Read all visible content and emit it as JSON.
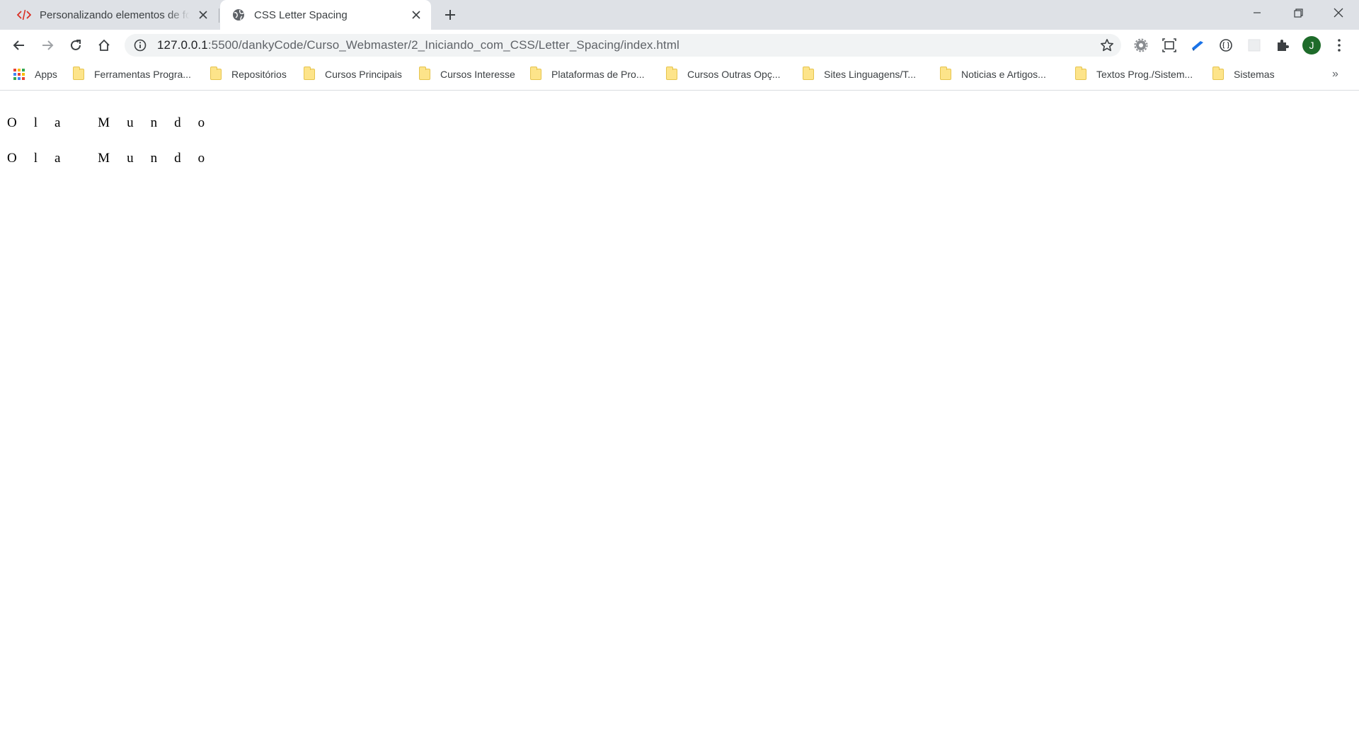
{
  "tabs": [
    {
      "title": "Personalizando elementos de formulário",
      "favicon": "code-icon",
      "active": false
    },
    {
      "title": "CSS Letter Spacing",
      "favicon": "globe-icon",
      "active": true
    }
  ],
  "window_controls": [
    "minimize",
    "restore",
    "close"
  ],
  "toolbar": {
    "url_host": "127.0.0.1",
    "url_rest": ":5500/dankyCode/Curso_Webmaster/2_Iniciando_com_CSS/Letter_Spacing/index.html",
    "avatar_letter": "J"
  },
  "bookmarks": {
    "items": [
      {
        "label": "Apps",
        "icon": "apps-grid-icon"
      },
      {
        "label": "Ferramentas Progra...",
        "icon": "folder-icon"
      },
      {
        "label": "Repositórios",
        "icon": "folder-icon"
      },
      {
        "label": "Cursos Principais",
        "icon": "folder-icon"
      },
      {
        "label": "Cursos Interesse",
        "icon": "folder-icon"
      },
      {
        "label": "Plataformas de Pro...",
        "icon": "folder-icon"
      },
      {
        "label": "Cursos Outras Opç...",
        "icon": "folder-icon"
      },
      {
        "label": "Sites Linguagens/T...",
        "icon": "folder-icon"
      },
      {
        "label": "Noticias e Artigos...",
        "icon": "folder-icon"
      },
      {
        "label": "Textos Prog./Sistem...",
        "icon": "folder-icon"
      },
      {
        "label": "Sistemas",
        "icon": "folder-icon"
      }
    ],
    "overflow": "»"
  },
  "page": {
    "paragraphs": [
      "Ola Mundo",
      "Ola Mundo"
    ]
  },
  "colors": {
    "tabstrip_bg": "#dee1e6",
    "omnibox_bg": "#f1f3f4",
    "avatar_bg": "#1e6b2a",
    "folder_yellow": "#fde48a",
    "code_icon_red": "#d93025"
  }
}
